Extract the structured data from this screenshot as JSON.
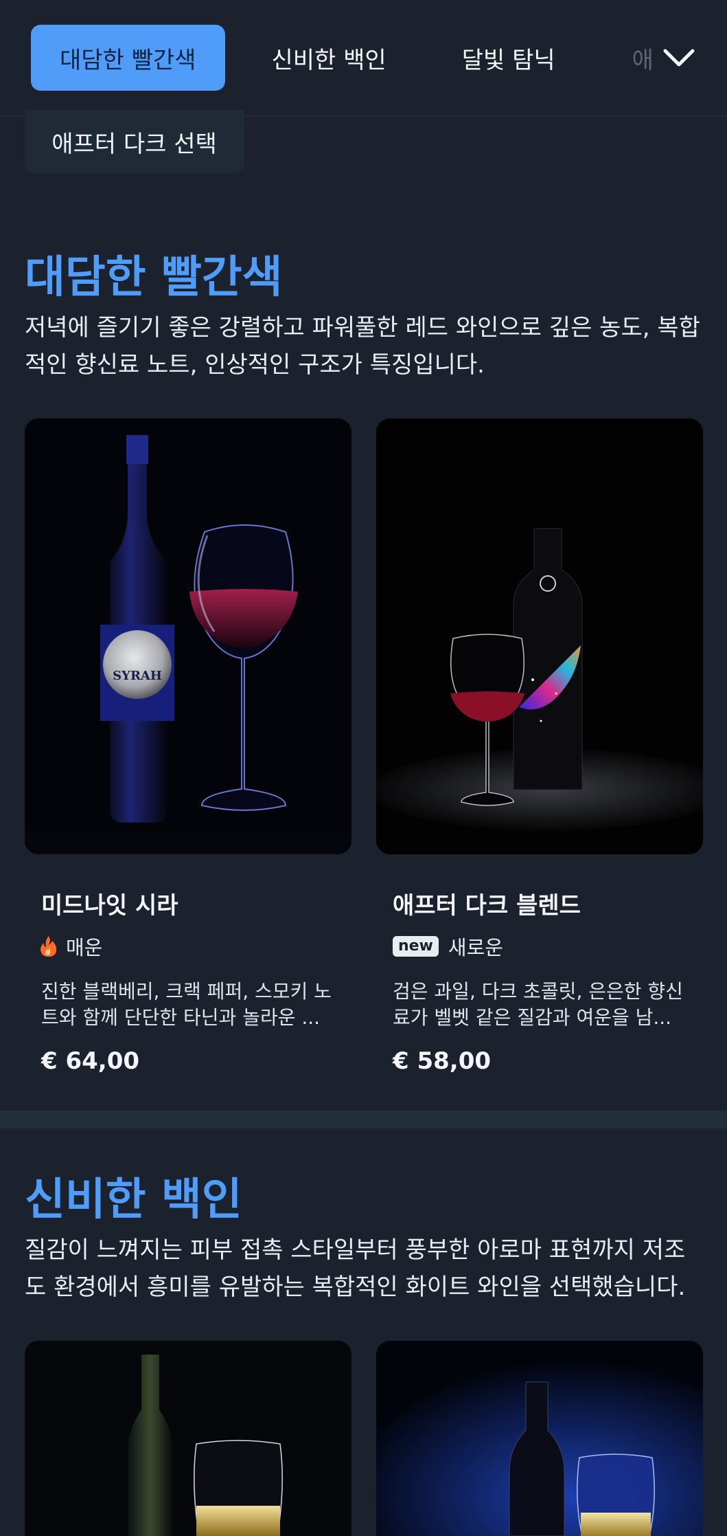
{
  "nav": {
    "tabs": [
      {
        "label": "대담한 빨간색"
      },
      {
        "label": "신비한 백인"
      },
      {
        "label": "달빛 탐닉"
      },
      {
        "label": "애"
      }
    ],
    "chip_label": "애프터 다크 선택",
    "accent": "#4f9cf9"
  },
  "sections": [
    {
      "title": "대담한 빨간색",
      "description": "저녁에 즐기기 좋은 강렬하고 파워풀한 레드 와인으로 깊은 농도, 복합적인 향신료 노트, 인상적인 구조가 특징입니다.",
      "products": [
        {
          "name": "미드나잇 시라",
          "tag_icon": "flame-icon",
          "tag": "매운",
          "description": "진한 블랙베리, 크랙 페퍼, 스모키 노트와 함께 단단한 타닌과 놀라운 ...",
          "price": "€ 64,00",
          "label_text": "SYRAH"
        },
        {
          "name": "애프터 다크 블렌드",
          "tag_icon": "new-badge",
          "badge": "new",
          "tag": "새로운",
          "description": "검은 과일, 다크 초콜릿, 은은한 향신료가 벨벳 같은 질감과 여운을 남...",
          "price": "€ 58,00"
        }
      ]
    },
    {
      "title": "신비한 백인",
      "description": "질감이 느껴지는 피부 접촉 스타일부터 풍부한 아로마 표현까지 저조도 환경에서 흥미를 유발하는 복합적인 화이트 와인을 선택했습니다."
    }
  ]
}
